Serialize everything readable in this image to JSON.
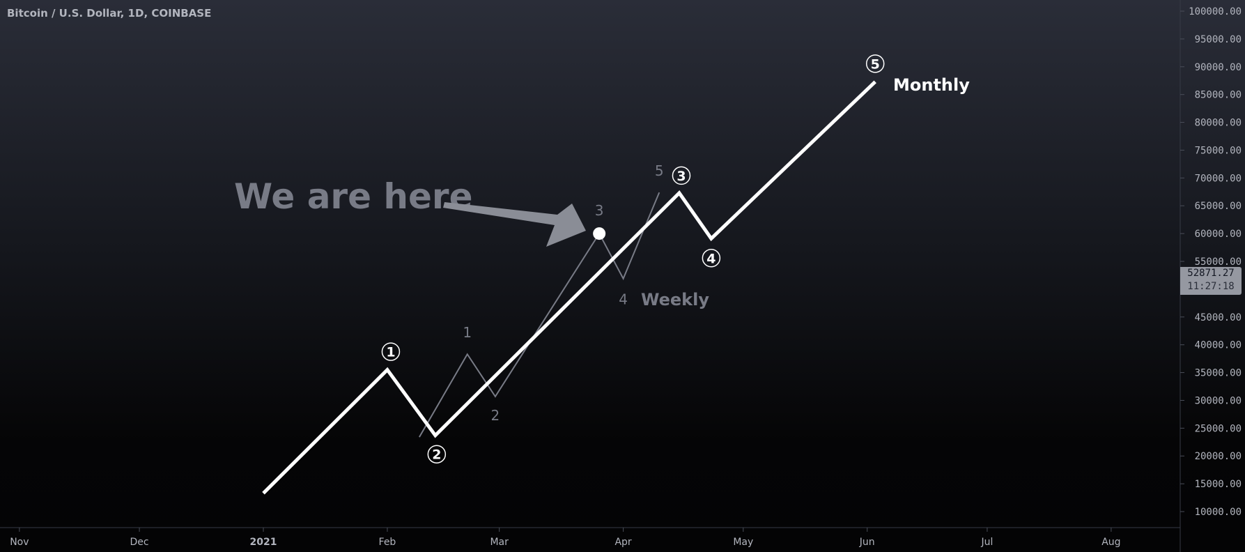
{
  "header": {
    "title": "Bitcoin / U.S. Dollar, 1D, COINBASE"
  },
  "price_label": {
    "price": "52871.27",
    "countdown": "11:27:18",
    "color": "#9598a1"
  },
  "chart_data": {
    "type": "line",
    "xlabel": "",
    "ylabel": "",
    "ylim": [
      10000,
      100000
    ],
    "x_ticks": [
      {
        "label": "Nov",
        "date": "2020-11-01"
      },
      {
        "label": "Dec",
        "date": "2020-12-01"
      },
      {
        "label": "2021",
        "date": "2021-01-01"
      },
      {
        "label": "Feb",
        "date": "2021-02-01"
      },
      {
        "label": "Mar",
        "date": "2021-03-01"
      },
      {
        "label": "Apr",
        "date": "2021-04-01"
      },
      {
        "label": "May",
        "date": "2021-05-01"
      },
      {
        "label": "Jun",
        "date": "2021-06-01"
      },
      {
        "label": "Jul",
        "date": "2021-07-01"
      },
      {
        "label": "Aug",
        "date": "2021-08-01"
      }
    ],
    "y_ticks": [
      "100000.00",
      "95000.00",
      "90000.00",
      "85000.00",
      "80000.00",
      "75000.00",
      "70000.00",
      "65000.00",
      "60000.00",
      "55000.00",
      "45000.00",
      "40000.00",
      "35000.00",
      "30000.00",
      "25000.00",
      "20000.00",
      "15000.00",
      "10000.00"
    ],
    "grid": false,
    "series": [
      {
        "name": "Monthly",
        "color": "#ffffff",
        "points": [
          {
            "date": "2021-01-01",
            "price": 13300,
            "label": ""
          },
          {
            "date": "2021-02-01",
            "price": 35500,
            "label": "1"
          },
          {
            "date": "2021-02-13",
            "price": 23700,
            "label": "2"
          },
          {
            "date": "2021-04-15",
            "price": 67300,
            "label": "3"
          },
          {
            "date": "2021-04-23",
            "price": 59100,
            "label": "4"
          },
          {
            "date": "2021-06-03",
            "price": 87300,
            "label": "5"
          }
        ]
      },
      {
        "name": "Weekly",
        "color": "#787b86",
        "points": [
          {
            "date": "2021-02-09",
            "price": 23400,
            "label": ""
          },
          {
            "date": "2021-02-21",
            "price": 38300,
            "label": "1"
          },
          {
            "date": "2021-02-28",
            "price": 30700,
            "label": "2"
          },
          {
            "date": "2021-03-26",
            "price": 60000,
            "label": "3"
          },
          {
            "date": "2021-04-01",
            "price": 51900,
            "label": "4"
          },
          {
            "date": "2021-04-10",
            "price": 67400,
            "label": "5"
          }
        ]
      }
    ],
    "annotations": [
      {
        "text": "We are here",
        "color": "#787b86",
        "points_to": {
          "date": "2021-03-26",
          "price": 60000
        }
      }
    ]
  }
}
